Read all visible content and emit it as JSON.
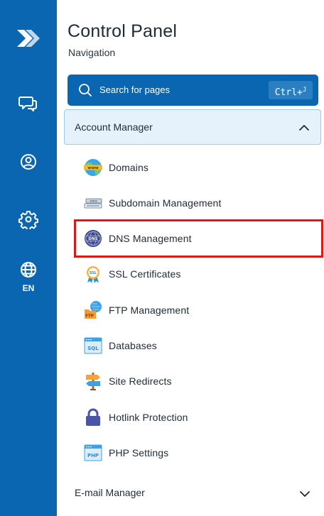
{
  "rail": {
    "logo_icon": "brand-logo-icon",
    "icons": [
      "chat-bubbles-icon",
      "user-circle-icon",
      "gear-icon",
      "globe-icon"
    ],
    "language": "EN",
    "color": "#0a66b1"
  },
  "header": {
    "title": "Control Panel",
    "subtitle": "Navigation"
  },
  "search": {
    "placeholder": "Search for pages",
    "shortcut_main": "Ctrl+",
    "shortcut_sup": "J"
  },
  "sections": [
    {
      "label": "Account Manager",
      "expanded": true,
      "items": [
        {
          "label": "Domains",
          "icon": "www-globe-icon"
        },
        {
          "label": "Subdomain Management",
          "icon": "subdomain-icon"
        },
        {
          "label": "DNS Management",
          "icon": "dns-icon",
          "highlighted": true
        },
        {
          "label": "SSL Certificates",
          "icon": "ssl-badge-icon"
        },
        {
          "label": "FTP Management",
          "icon": "ftp-icon"
        },
        {
          "label": "Databases",
          "icon": "sql-database-icon"
        },
        {
          "label": "Site Redirects",
          "icon": "signpost-icon"
        },
        {
          "label": "Hotlink Protection",
          "icon": "lock-icon"
        },
        {
          "label": "PHP Settings",
          "icon": "php-icon"
        }
      ]
    },
    {
      "label": "E-mail Manager",
      "expanded": false
    }
  ],
  "highlight_color": "#d61b1b"
}
